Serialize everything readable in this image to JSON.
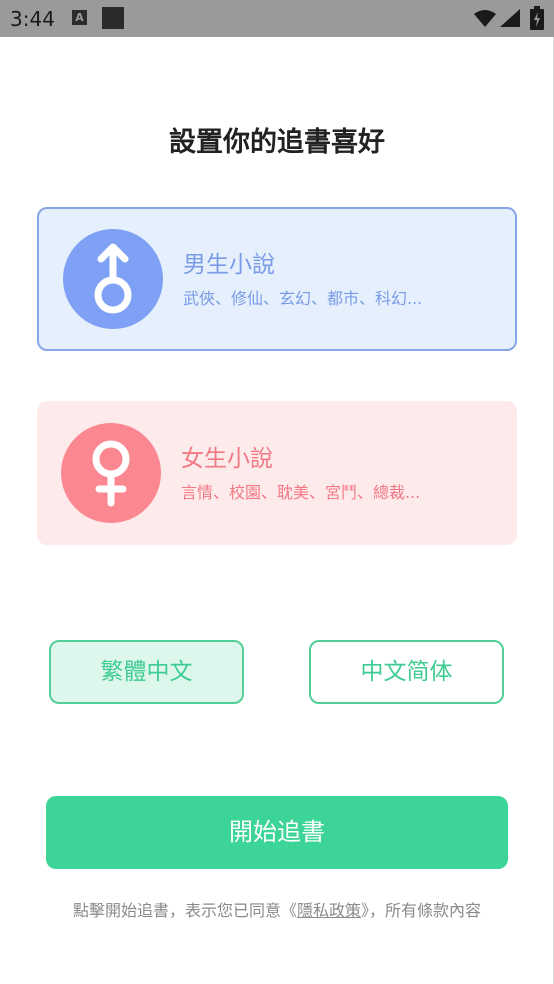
{
  "status_bar": {
    "time": "3:44",
    "icons": [
      "notification-a-icon",
      "square-notification-icon",
      "wifi-icon",
      "signal-icon",
      "battery-icon"
    ]
  },
  "title": "設置你的追書喜好",
  "cards": {
    "male": {
      "title": "男生小說",
      "subtitle": "武俠、修仙、玄幻、都市、科幻...",
      "icon": "male-symbol-icon",
      "selected": true
    },
    "female": {
      "title": "女生小說",
      "subtitle": "言情、校園、耽美、宮鬥、總裁...",
      "icon": "female-symbol-icon",
      "selected": false
    }
  },
  "language": {
    "traditional": "繁體中文",
    "simplified": "中文简体",
    "selected": "traditional"
  },
  "start_button": "開始追書",
  "footer": {
    "prefix": "點擊開始追書，表示您已同意《",
    "policy_link": "隱私政策",
    "suffix": "》，所有條款內容"
  },
  "colors": {
    "accent_green": "#3dd597",
    "male_blue": "#7fa1f5",
    "female_pink": "#fb8790"
  }
}
